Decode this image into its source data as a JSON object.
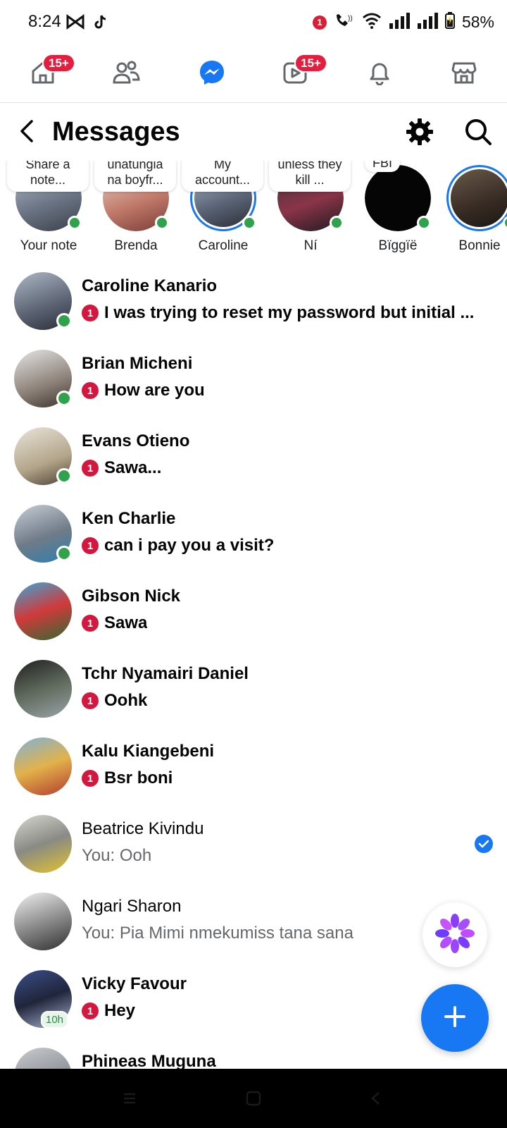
{
  "status_bar": {
    "time": "8:24",
    "notification_count": "1",
    "battery": "58%"
  },
  "top_nav": {
    "home_badge": "15+",
    "video_badge": "15+"
  },
  "header": {
    "title": "Messages"
  },
  "notes": [
    {
      "note": "Share a note...",
      "name": "Your note",
      "online": true
    },
    {
      "note": "unatungia na boyfr...",
      "name": "Brenda",
      "online": true
    },
    {
      "note": "My account...",
      "name": "Caroline",
      "online": true
    },
    {
      "note": "unless they kill ...",
      "name": "Ní",
      "online": true
    },
    {
      "note": "FBI",
      "name": "Bïggïë",
      "online": true
    },
    {
      "note": "",
      "name": "Bonnie",
      "online": true
    }
  ],
  "conversations": [
    {
      "name": "Caroline Kanario",
      "preview": "I was trying to reset my password but initial ...",
      "unread": true,
      "badge": "1",
      "online": true
    },
    {
      "name": "Brian Micheni",
      "preview": "How are you",
      "unread": true,
      "badge": "1",
      "online": true
    },
    {
      "name": "Evans Otieno",
      "preview": "Sawa...",
      "unread": true,
      "badge": "1",
      "online": true
    },
    {
      "name": "Ken Charlie",
      "preview": "can i pay you a visit?",
      "unread": true,
      "badge": "1",
      "online": true
    },
    {
      "name": "Gibson Nick",
      "preview": "Sawa",
      "unread": true,
      "badge": "1",
      "online": false
    },
    {
      "name": "Tchr Nyamairi Daniel",
      "preview": "Oohk",
      "unread": true,
      "badge": "1",
      "online": false
    },
    {
      "name": "Kalu Kiangebeni",
      "preview": "Bsr boni",
      "unread": true,
      "badge": "1",
      "online": false
    },
    {
      "name": "Beatrice Kivindu",
      "preview": "You: Ooh",
      "unread": false,
      "badge": "",
      "online": false,
      "seen": true
    },
    {
      "name": "Ngari Sharon",
      "preview": "You: Pia Mimi nmekumiss tana sana",
      "unread": false,
      "badge": "",
      "online": false,
      "seen": true
    },
    {
      "name": "Vicky Favour",
      "preview": "Hey",
      "unread": true,
      "badge": "1",
      "online": false,
      "active_ago": "10h"
    },
    {
      "name": "Phineas Muguna",
      "preview": "",
      "unread": true,
      "badge": "",
      "online": false
    }
  ],
  "colors": {
    "accent": "#1877f2",
    "badge_red": "#d4173e",
    "online_green": "#31a24c"
  },
  "icons": {
    "compose": "plus-icon",
    "meta_ai": "meta-ai-icon"
  }
}
